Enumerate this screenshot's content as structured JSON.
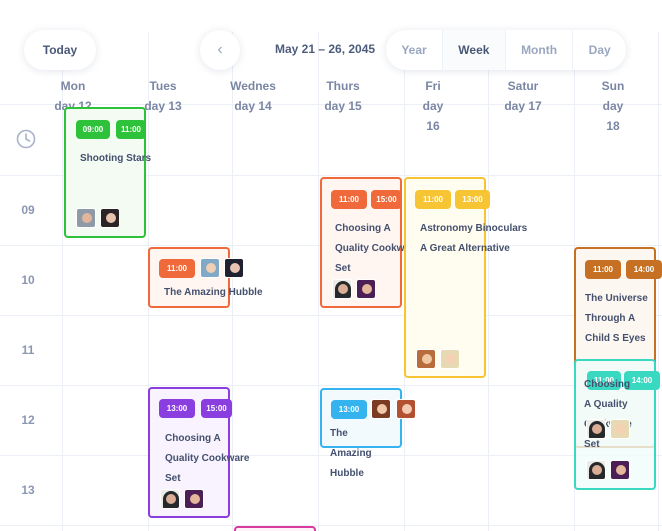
{
  "toolbar": {
    "today_label": "Today",
    "prev_icon": "chevron-left-icon",
    "prev_glyph": "‹",
    "date_range": "May 21 – 26, 2045",
    "views": [
      "Year",
      "Week",
      "Month",
      "Day"
    ],
    "active_view": "Week"
  },
  "days": [
    {
      "line1": "Mon",
      "line2": "day 12",
      "line3": ""
    },
    {
      "line1": "Tues",
      "line2": "day 13",
      "line3": ""
    },
    {
      "line1": "Wednes",
      "line2": "day 14",
      "line3": ""
    },
    {
      "line1": "Thurs",
      "line2": "day 15",
      "line3": ""
    },
    {
      "line1": "Fri",
      "line2": "day",
      "line3": "16"
    },
    {
      "line1": "Satur",
      "line2": "day 17",
      "line3": ""
    },
    {
      "line1": "Sun",
      "line2": "day",
      "line3": "18"
    }
  ],
  "hours": [
    "09",
    "10",
    "11",
    "12",
    "13"
  ],
  "clock_icon": "clock-icon",
  "colors": {
    "green": "#2ec23a",
    "orange": "#f0693a",
    "yellow": "#f7c534",
    "purple": "#8a3ee0",
    "blue": "#35b3ee",
    "brown": "#c67024",
    "teal": "#39d8c0",
    "magenta": "#d83aa0"
  },
  "events": [
    {
      "title": "Shooting Stars",
      "start": "09:00",
      "end": "11:00",
      "color": "green"
    },
    {
      "title": "The Amazing Hubble",
      "start": "11:00",
      "end": "",
      "color": "orange"
    },
    {
      "title": "Choosing A Quality Cookware Set",
      "start": "11:00",
      "end": "15:00",
      "color": "orange"
    },
    {
      "title": "Astronomy Binoculars A Great Alternative",
      "start": "11:00",
      "end": "13:00",
      "color": "yellow"
    },
    {
      "title": "Choosing A Quality Cookware Set",
      "start": "13:00",
      "end": "15:00",
      "color": "purple"
    },
    {
      "title": "The Amazing Hubble",
      "start": "13:00",
      "end": "",
      "color": "blue"
    },
    {
      "title": "The Universe Through A Child S Eyes",
      "start": "11:00",
      "end": "14:00",
      "color": "brown"
    },
    {
      "title": "Choosing A Quality Cookware Set",
      "start": "11:00",
      "end": "14:00",
      "color": "teal"
    }
  ]
}
